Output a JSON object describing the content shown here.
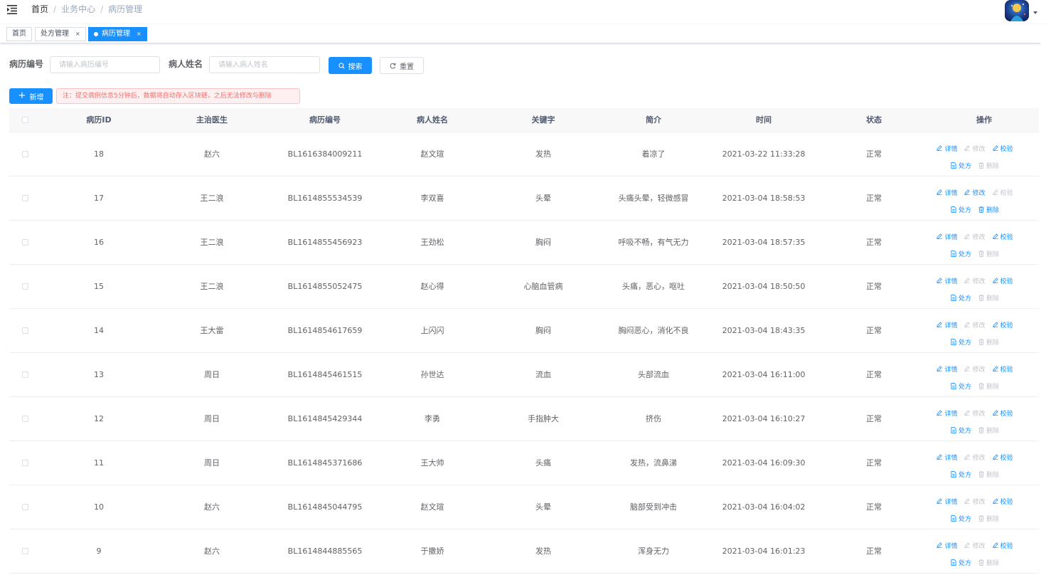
{
  "navbar": {
    "breadcrumb": [
      "首页",
      "业务中心",
      "病历管理"
    ],
    "breadcrumb_separator": "/"
  },
  "tags": [
    {
      "label": "首页",
      "active": false,
      "closable": false
    },
    {
      "label": "处方管理",
      "active": false,
      "closable": true
    },
    {
      "label": "病历管理",
      "active": true,
      "closable": true
    }
  ],
  "tag_close_symbol": "×",
  "search": {
    "record_no_label": "病历编号",
    "record_no_placeholder": "请输入病历编号",
    "record_no_value": "",
    "patient_label": "病人姓名",
    "patient_placeholder": "请输入病人姓名",
    "patient_value": "",
    "search_button": "搜索",
    "reset_button": "重置"
  },
  "toolbar": {
    "add_button": "新增",
    "notice": "注：提交病例信息5分钟后，数据将自动存入区块链，之后无法修改与删除"
  },
  "table": {
    "columns": [
      "病历ID",
      "主治医生",
      "病历编号",
      "病人姓名",
      "关键字",
      "简介",
      "时间",
      "状态",
      "操作"
    ],
    "actions": {
      "detail": "详情",
      "edit": "修改",
      "verify": "校验",
      "prescription": "处方",
      "delete": "删除"
    },
    "rows": [
      {
        "id": "18",
        "doctor": "赵六",
        "record_no": "BL1616384009211",
        "patient": "赵文瑄",
        "keyword": "发热",
        "summary": "着凉了",
        "time": "2021-03-22 11:33:28",
        "status": "正常",
        "editable": false,
        "verifiable": true,
        "deletable": false
      },
      {
        "id": "17",
        "doctor": "王二浪",
        "record_no": "BL1614855534539",
        "patient": "李双喜",
        "keyword": "头晕",
        "summary": "头痛头晕，轻微感冒",
        "time": "2021-03-04 18:58:53",
        "status": "正常",
        "editable": true,
        "verifiable": false,
        "deletable": true
      },
      {
        "id": "16",
        "doctor": "王二浪",
        "record_no": "BL1614855456923",
        "patient": "王劲松",
        "keyword": "胸闷",
        "summary": "呼吸不畅，有气无力",
        "time": "2021-03-04 18:57:35",
        "status": "正常",
        "editable": false,
        "verifiable": true,
        "deletable": false
      },
      {
        "id": "15",
        "doctor": "王二浪",
        "record_no": "BL1614855052475",
        "patient": "赵心得",
        "keyword": "心脑血管病",
        "summary": "头痛，恶心，呕吐",
        "time": "2021-03-04 18:50:50",
        "status": "正常",
        "editable": false,
        "verifiable": true,
        "deletable": false
      },
      {
        "id": "14",
        "doctor": "王大雷",
        "record_no": "BL1614854617659",
        "patient": "上闪闪",
        "keyword": "胸闷",
        "summary": "胸闷恶心，消化不良",
        "time": "2021-03-04 18:43:35",
        "status": "正常",
        "editable": false,
        "verifiable": true,
        "deletable": false
      },
      {
        "id": "13",
        "doctor": "周日",
        "record_no": "BL1614845461515",
        "patient": "孙世达",
        "keyword": "流血",
        "summary": "头部流血",
        "time": "2021-03-04 16:11:00",
        "status": "正常",
        "editable": false,
        "verifiable": true,
        "deletable": false
      },
      {
        "id": "12",
        "doctor": "周日",
        "record_no": "BL1614845429344",
        "patient": "李勇",
        "keyword": "手指肿大",
        "summary": "挤伤",
        "time": "2021-03-04 16:10:27",
        "status": "正常",
        "editable": false,
        "verifiable": true,
        "deletable": false
      },
      {
        "id": "11",
        "doctor": "周日",
        "record_no": "BL1614845371686",
        "patient": "王大帅",
        "keyword": "头痛",
        "summary": "发热，流鼻涕",
        "time": "2021-03-04 16:09:30",
        "status": "正常",
        "editable": false,
        "verifiable": true,
        "deletable": false
      },
      {
        "id": "10",
        "doctor": "赵六",
        "record_no": "BL1614845044795",
        "patient": "赵文瑄",
        "keyword": "头晕",
        "summary": "脑部受到冲击",
        "time": "2021-03-04 16:04:02",
        "status": "正常",
        "editable": false,
        "verifiable": true,
        "deletable": false
      },
      {
        "id": "9",
        "doctor": "赵六",
        "record_no": "BL1614844885565",
        "patient": "于撒娇",
        "keyword": "发热",
        "summary": "浑身无力",
        "time": "2021-03-04 16:01:23",
        "status": "正常",
        "editable": false,
        "verifiable": true,
        "deletable": false
      }
    ]
  },
  "colors": {
    "primary": "#1890ff",
    "disabled": "#c0c4cc",
    "danger_text": "#f56c6c",
    "danger_bg": "#fef0f0",
    "header_bg": "#f8f8f9"
  },
  "icons": [
    "hamburger-icon",
    "avatar",
    "caret-down-icon",
    "search-icon",
    "refresh-icon",
    "plus-icon",
    "edit-icon",
    "document-icon",
    "trash-icon"
  ]
}
